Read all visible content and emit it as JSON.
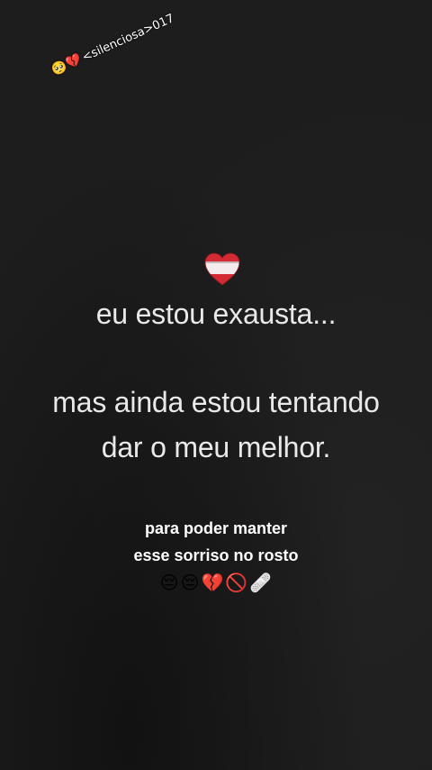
{
  "watermark": {
    "emojis": "🥺💔",
    "text": "<silenciosa>017"
  },
  "headline": {
    "line1": "eu estou exausta...",
    "line2": "mas ainda estou tentando",
    "line3": "dar o meu melhor."
  },
  "caption": {
    "line1": "para poder manter",
    "line2": "esse sorriso no rosto",
    "emojis": [
      "😔",
      "😔",
      "💔",
      "🚫",
      "🩹"
    ]
  },
  "icons": [
    "heart-icon",
    "pleading-face-icon",
    "broken-heart-icon",
    "pensive-face-icon",
    "prohibited-icon",
    "bandage-icon"
  ],
  "colors": {
    "background": "#1c1c1c",
    "text": "#e9e9e9",
    "heart_red": "#c8252e"
  }
}
